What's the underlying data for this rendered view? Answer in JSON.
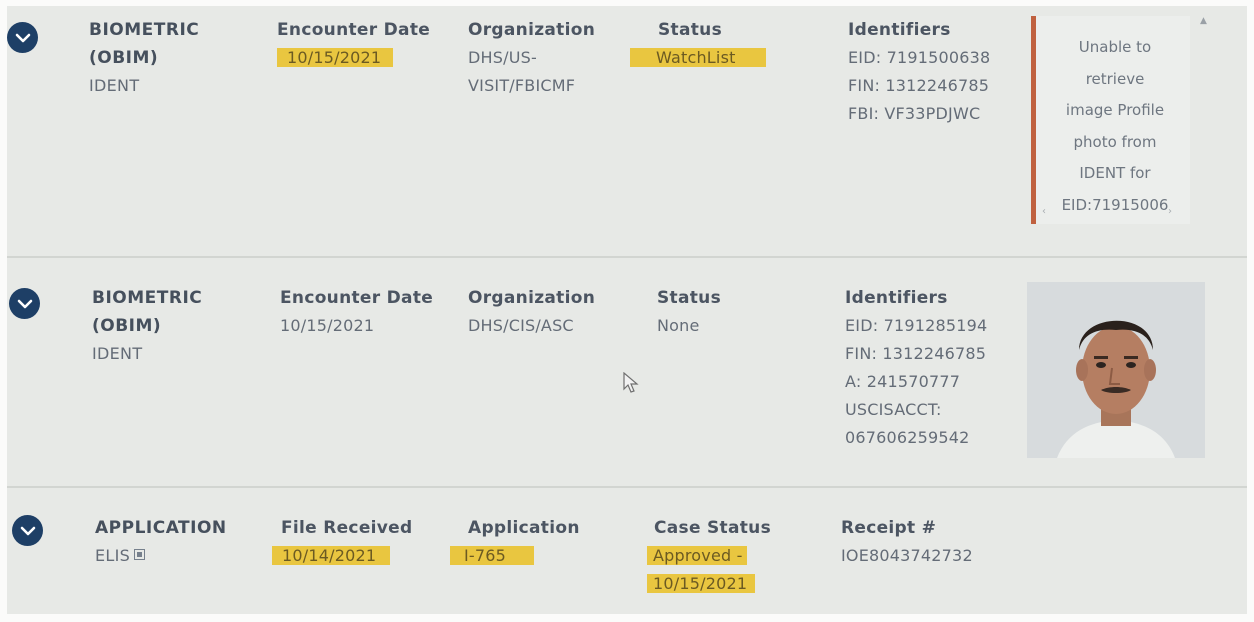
{
  "records": [
    {
      "source": "BIOMETRIC",
      "source_cont": "(OBIM)",
      "system": "IDENT",
      "col2": {
        "label": "Encounter Date",
        "value": "10/15/2021"
      },
      "col3": {
        "label": "Organization",
        "lines": [
          "DHS/US-",
          "VISIT/FBICMF"
        ]
      },
      "col4": {
        "label": "Status",
        "value": "WatchList"
      },
      "col5": {
        "label": "Identifiers",
        "lines": [
          "EID: 7191500638",
          "FIN: 1312246785",
          "FBI: VF33PDJWC"
        ]
      },
      "photo_message": [
        "Unable to",
        "retrieve",
        "image Profile",
        "photo from",
        "IDENT for",
        "EID:71915006"
      ]
    },
    {
      "source": "BIOMETRIC",
      "source_cont": "(OBIM)",
      "system": "IDENT",
      "col2": {
        "label": "Encounter Date",
        "value": "10/15/2021"
      },
      "col3": {
        "label": "Organization",
        "value": "DHS/CIS/ASC"
      },
      "col4": {
        "label": "Status",
        "value": "None"
      },
      "col5": {
        "label": "Identifiers",
        "lines": [
          "EID: 7191285194",
          "FIN: 1312246785",
          "A: 241570777",
          "USCISACCT:",
          "067606259542"
        ]
      }
    },
    {
      "source": "APPLICATION",
      "system": "ELIS",
      "col2": {
        "label": "File Received",
        "value": "10/14/2021"
      },
      "col3": {
        "label": "Application",
        "value": "I-765"
      },
      "col4": {
        "label": "Case Status",
        "lines": [
          "Approved -",
          "10/15/2021"
        ]
      },
      "col5": {
        "label": "Receipt #",
        "value": "IOE8043742732"
      }
    }
  ],
  "icons": {
    "expand": "chevron-down-icon",
    "external_link": "external-link-icon",
    "cursor": "mouse-pointer-icon"
  },
  "colors": {
    "highlight": "#e9c640",
    "chevron_bg": "#1e3f66",
    "photo_border": "#c0613f",
    "background": "#e7e9e6"
  }
}
